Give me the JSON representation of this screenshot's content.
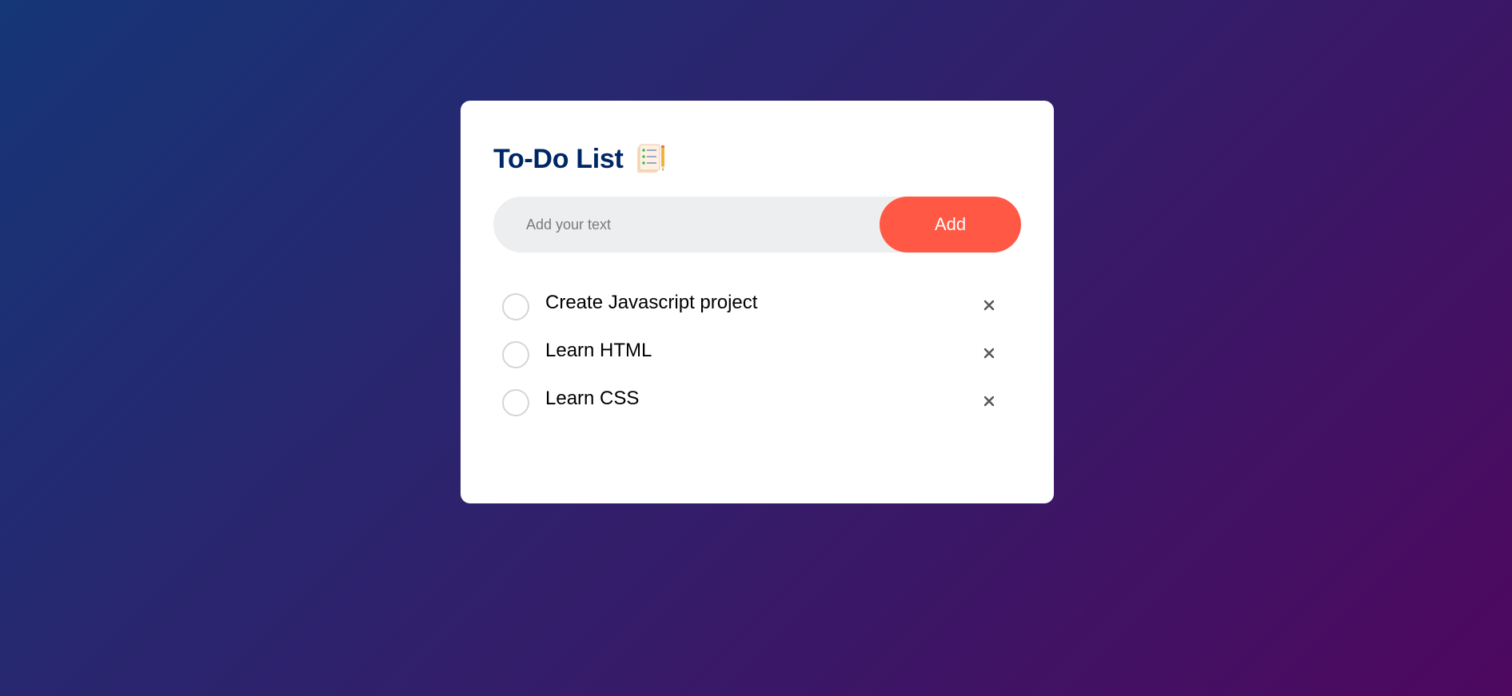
{
  "app": {
    "title": "To-Do List"
  },
  "input": {
    "placeholder": "Add your text",
    "value": ""
  },
  "buttons": {
    "add_label": "Add"
  },
  "tasks": [
    {
      "text": "Create Javascript project",
      "checked": false
    },
    {
      "text": "Learn HTML",
      "checked": false
    },
    {
      "text": "Learn CSS",
      "checked": false
    }
  ],
  "icons": {
    "title": "checklist-notepad-icon",
    "check": "circle-check-icon",
    "delete": "close-icon"
  },
  "colors": {
    "background_start": "#153677",
    "background_end": "#4e085f",
    "title": "#002765",
    "accent": "#ff5945",
    "input_bg": "#edeef0",
    "check_border": "#d5d5d5",
    "delete_icon": "#555555"
  }
}
